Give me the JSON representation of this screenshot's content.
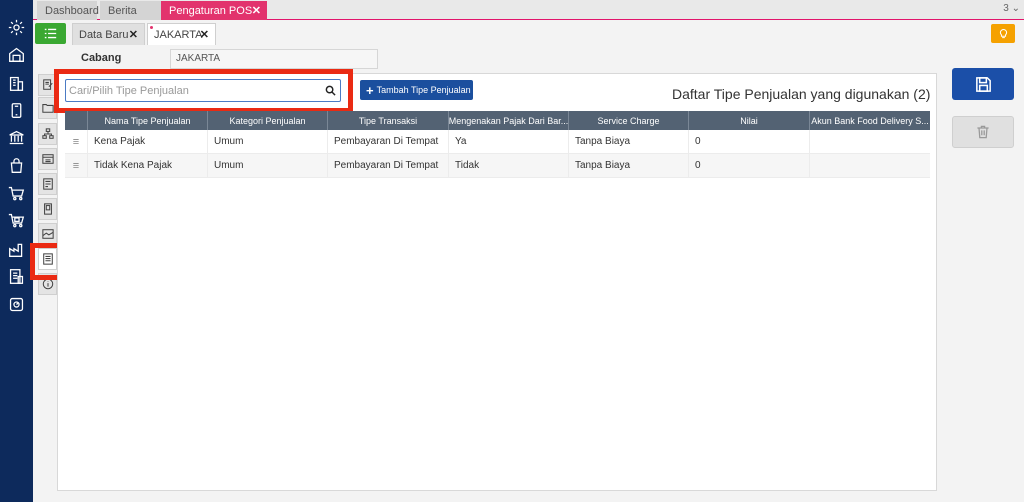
{
  "top_tabs": [
    {
      "label": "Dashboard"
    },
    {
      "label": "Berita"
    },
    {
      "label": "Pengaturan POS"
    }
  ],
  "top_tab_count": "3",
  "sub_tabs": [
    {
      "label": "Data Baru"
    },
    {
      "label": "JAKARTA"
    }
  ],
  "cabang": {
    "label": "Cabang",
    "value": "JAKARTA"
  },
  "search": {
    "placeholder": "Cari/Pilih Tipe Penjualan"
  },
  "add_button": {
    "label": "Tambah Tipe Penjualan"
  },
  "list_title": "Daftar Tipe Penjualan yang digunakan  (2)",
  "table": {
    "headers": [
      "",
      "Nama Tipe Penjualan",
      "Kategori Penjualan",
      "Tipe Transaksi",
      "Mengenakan Pajak Dari Bar...",
      "Service Charge",
      "Nilai",
      "Akun Bank Food Delivery S..."
    ],
    "rows": [
      {
        "nama": "Kena Pajak",
        "kategori": "Umum",
        "tipe": "Pembayaran Di Tempat",
        "pajak": "Ya",
        "service": "Tanpa Biaya",
        "nilai": "0",
        "akun": ""
      },
      {
        "nama": "Tidak Kena Pajak",
        "kategori": "Umum",
        "tipe": "Pembayaran Di Tempat",
        "pajak": "Tidak",
        "service": "Tanpa Biaya",
        "nilai": "0",
        "akun": ""
      }
    ]
  },
  "colors": {
    "navy": "#0d2a5c",
    "accent": "#e2336d",
    "primary": "#1b4f9e",
    "highlight": "#ea2a13"
  }
}
